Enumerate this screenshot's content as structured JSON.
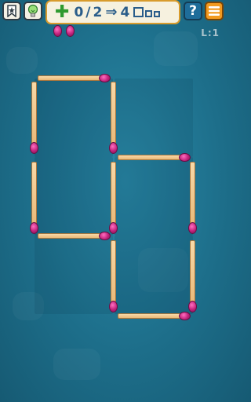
{
  "hud": {
    "moves_current": "0",
    "moves_separator": "/",
    "moves_total": "2",
    "target_count": "4",
    "level_label": "L:1"
  },
  "icons": {
    "bookmark": "bookmark-star-icon",
    "hint": "lightbulb-icon",
    "help": "question-icon",
    "menu": "hamburger-menu-icon",
    "plus": "plus-icon",
    "arrow": "double-arrow-icon",
    "squares": "squares-goal-icon"
  },
  "colors": {
    "background": "#1d6e8a",
    "stick": "#f3cf97",
    "match_head": "#c4247e",
    "pill_border": "#d89b2c",
    "menu_button": "#f29a1f"
  }
}
